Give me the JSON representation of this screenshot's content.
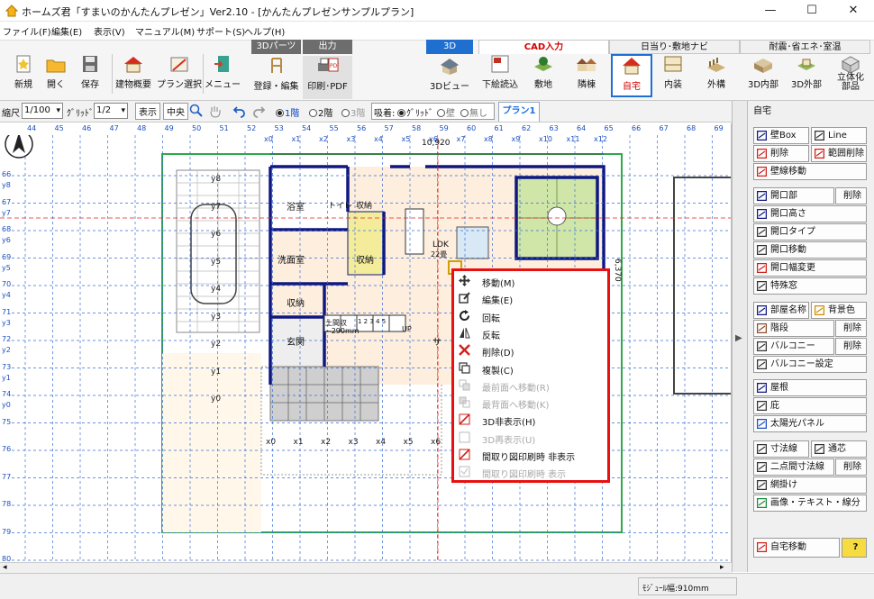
{
  "window": {
    "title": "ホームズ君「すまいのかんたんプレゼン」Ver2.10 - [かんたんプレゼンサンプルプラン]",
    "minimize": "—",
    "maximize": "☐",
    "close": "✕"
  },
  "menu": [
    "ファイル(F)",
    "編集(E)",
    "表示(V)",
    "マニュアル(M)",
    "サポート(S)",
    "ヘルプ(H)"
  ],
  "toolbar": {
    "new": "新規",
    "open": "開く",
    "save": "保存",
    "building_summary": "建物概要",
    "plan_select": "プラン選択",
    "menu": "メニュー",
    "parts_header": "3Dパーツ",
    "register_edit": "登録・編集",
    "output_header": "出力",
    "print_pdf": "印刷･PDF",
    "view3d_header": "3D",
    "view3d": "3Dビュー",
    "cad_tab": "CAD入力",
    "sun_tab": "日当り･敷地ナビ",
    "quake_tab": "耐震･省エネ･室温",
    "trace": "下絵読込",
    "site": "敷地",
    "neighbor": "隣棟",
    "own_house": "自宅",
    "interior": "内装",
    "exterior": "外構",
    "in3d": "3D内部",
    "out3d": "3D外部",
    "solid": "立体化",
    "solid2": "部品"
  },
  "bar2": {
    "scale_label": "縮尺",
    "scale_value": "1/100",
    "grid_label": "ｸﾞﾘｯﾄﾞ",
    "grid_value": "1/2",
    "display": "表示",
    "center": "中央",
    "floor1": "1階",
    "floor2": "2階",
    "floor3": "3階",
    "snap_label": "吸着:",
    "snap_grid": "ｸﾞﾘｯﾄﾞ",
    "snap_wall": "壁",
    "snap_none": "無し",
    "plan_tab": "プラン1"
  },
  "ruler_top": [
    "44",
    "45",
    "46",
    "47",
    "48",
    "49",
    "50",
    "51",
    "52",
    "53",
    "54",
    "55",
    "56",
    "57",
    "58",
    "59",
    "60",
    "61",
    "62",
    "63",
    "64",
    "65",
    "66",
    "67",
    "68",
    "69"
  ],
  "x_labels": [
    "x0",
    "x1",
    "x2",
    "x3",
    "x4",
    "x5",
    "x6",
    "x7",
    "x8",
    "x9",
    "x10",
    "x11",
    "x12"
  ],
  "ruler_left": [
    "66",
    "67",
    "68",
    "69",
    "70",
    "71",
    "72",
    "73",
    "74",
    "75",
    "76",
    "77",
    "78",
    "79",
    "80"
  ],
  "y_labels": [
    "y8",
    "y7",
    "y6",
    "y5",
    "y4",
    "y3",
    "y2",
    "y1",
    "y0"
  ],
  "plan": {
    "dim_top": "10,920",
    "dim_right": "6,370",
    "bath": "浴室",
    "toilet": "トイレ",
    "storage1": "収納",
    "washroom": "洗面室",
    "storage2": "収納",
    "storage3": "収納",
    "entrance_storage": "土間収",
    "entrance_storage_dim": "~290mm",
    "entrance": "玄関",
    "ldk": "LDK",
    "ldk_size": "22畳",
    "up": "UP",
    "stairs": "1 2 3 4 5",
    "sa": "サ"
  },
  "context_menu": [
    {
      "label": "移動(M)",
      "icon": "move-icon",
      "enabled": true
    },
    {
      "label": "編集(E)",
      "icon": "edit-icon",
      "enabled": true
    },
    {
      "label": "回転",
      "icon": "rotate-icon",
      "enabled": true
    },
    {
      "label": "反転",
      "icon": "flip-icon",
      "enabled": true
    },
    {
      "label": "削除(D)",
      "icon": "delete-icon",
      "enabled": true
    },
    {
      "label": "複製(C)",
      "icon": "copy-icon",
      "enabled": true
    },
    {
      "label": "最前面へ移動(R)",
      "icon": "bring-front-icon",
      "enabled": false
    },
    {
      "label": "最背面へ移動(K)",
      "icon": "send-back-icon",
      "enabled": false
    },
    {
      "label": "3D非表示(H)",
      "icon": "hide3d-icon",
      "enabled": true
    },
    {
      "label": "3D再表示(U)",
      "icon": "show3d-icon",
      "enabled": false
    },
    {
      "label": "間取り図印刷時 非表示",
      "icon": "print-hide-icon",
      "enabled": true
    },
    {
      "label": "間取り図印刷時 表示",
      "icon": "print-show-icon",
      "enabled": false
    }
  ],
  "panel": {
    "header": "自宅",
    "wall_box": "壁Box",
    "line": "Line",
    "delete": "削除",
    "range_delete": "範囲削除",
    "wall_move": "壁線移動",
    "opening": "開口部",
    "opening_delete": "削除",
    "opening_height": "開口高さ",
    "opening_type": "開口タイプ",
    "opening_move": "開口移動",
    "opening_width": "開口幅変更",
    "special_window": "特殊窓",
    "room_name": "部屋名称",
    "bg_color": "背景色",
    "stairs": "階段",
    "stairs_delete": "削除",
    "balcony": "バルコニー",
    "balcony_delete": "削除",
    "balcony_setting": "バルコニー設定",
    "roof": "屋根",
    "eaves": "庇",
    "solar": "太陽光パネル",
    "dimension": "寸法線",
    "through_center": "通芯",
    "two_point_dim": "二点間寸法線",
    "two_point_delete": "削除",
    "hatching": "網掛け",
    "image_text": "画像・テキスト・線分",
    "house_move": "自宅移動",
    "help": "?"
  },
  "status": {
    "module": "ﾓｼﾞｭｰﾙ幅:910mm"
  },
  "colors": {
    "accent_red": "#e81010",
    "cad_red": "#d40000",
    "wall": "#101880",
    "grid_blue": "#3a6fd8",
    "site_green": "#2fa84a"
  }
}
